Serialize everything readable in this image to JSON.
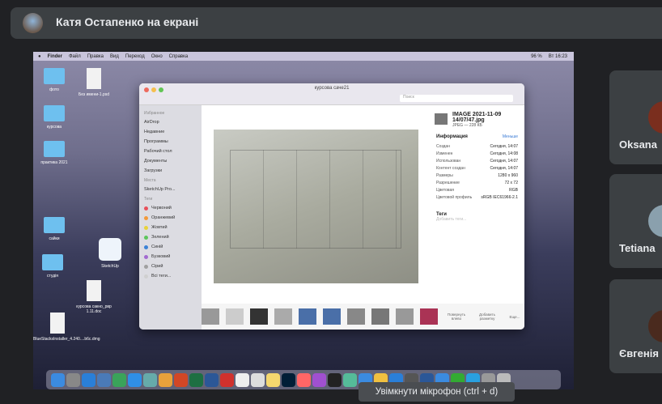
{
  "presenter": {
    "text": "Катя Остапенко на екрані"
  },
  "mac": {
    "menu": [
      "Finder",
      "Файл",
      "Правка",
      "Вид",
      "Переход",
      "Окно",
      "Справка"
    ],
    "status": [
      "96 %",
      "Вт 16:23"
    ],
    "desktop_icons": [
      "фото",
      "Без имени-1.psd",
      "курсова",
      "практика 2021",
      "сайки",
      "студія",
      "SketchUp",
      "курсова сакно_рвр 1.11.doc",
      "BlueStacksInstaller_4.240....b6c.dmg"
    ],
    "finder": {
      "title": "курсова саче21",
      "search_placeholder": "Поиск",
      "favorites_header": "Избранное",
      "favorites": [
        "AirDrop",
        "Недавние",
        "Программы",
        "Рабочий стол",
        "Документы",
        "Загрузки"
      ],
      "places_header": "Места",
      "places": [
        "SketchUp Pro..."
      ],
      "tags_header": "Теги",
      "tags": [
        {
          "label": "Червоний",
          "color": "#e8505b"
        },
        {
          "label": "Оранжевий",
          "color": "#f29a3b"
        },
        {
          "label": "Жовтий",
          "color": "#e8d23b"
        },
        {
          "label": "Зелений",
          "color": "#5cc65c"
        },
        {
          "label": "Синій",
          "color": "#3b82d6"
        },
        {
          "label": "Бузковий",
          "color": "#a26ad0"
        },
        {
          "label": "Сірий",
          "color": "#a0a0a0"
        },
        {
          "label": "Всі теги...",
          "color": "#d0d0d0"
        }
      ],
      "file_name": "IMAGE 2021-11-09 14/07/47.jpg",
      "file_type": "JPEG — 228 КБ",
      "info_header": "Информация",
      "info_more": "Меньше",
      "info_rows": [
        [
          "Создан",
          "Сегодня, 14:07"
        ],
        [
          "Изменен",
          "Сегодня, 14:08"
        ],
        [
          "Использован",
          "Сегодня, 14:07"
        ],
        [
          "Контент создан",
          "Сегодня, 14:07"
        ],
        [
          "Размеры",
          "1280 x 960"
        ],
        [
          "Разрешение",
          "72 x 72"
        ],
        [
          "Цветовая",
          "RGB"
        ],
        [
          "Цветовой профиль",
          "sRGB IEC61966-2.1"
        ]
      ],
      "tags_section": "Теги",
      "tags_placeholder": "Добавить теги...",
      "actions": [
        "Повернуть влево",
        "Добавить разметку",
        "Еще..."
      ]
    }
  },
  "participants": [
    {
      "name": "Oksana",
      "color": "#7a2e1e"
    },
    {
      "name": "Tetiana",
      "color": "#8aa0ad"
    },
    {
      "name": "Євгенія",
      "color": "#4a2a1e"
    }
  ],
  "tooltip": "Увімкнути мікрофон (ctrl + d)"
}
